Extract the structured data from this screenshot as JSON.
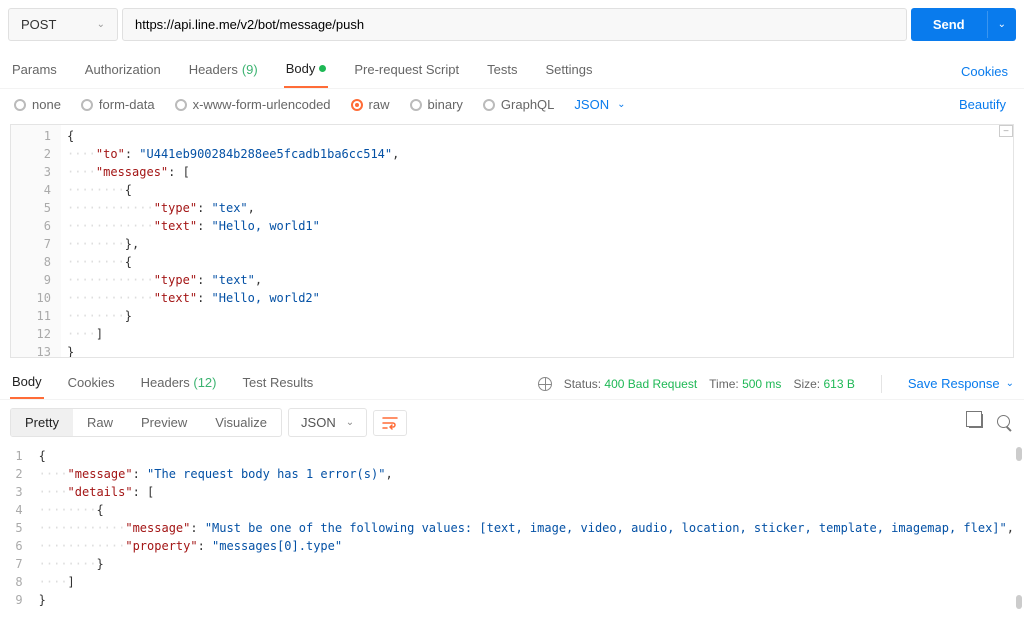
{
  "method": "POST",
  "url": "https://api.line.me/v2/bot/message/push",
  "send_label": "Send",
  "tabs": {
    "params": "Params",
    "authorization": "Authorization",
    "headers": "Headers",
    "headers_count": "(9)",
    "body": "Body",
    "prerequest": "Pre-request Script",
    "tests": "Tests",
    "settings": "Settings",
    "cookies": "Cookies"
  },
  "body_types": {
    "none": "none",
    "formdata": "form-data",
    "xwww": "x-www-form-urlencoded",
    "raw": "raw",
    "binary": "binary",
    "graphql": "GraphQL"
  },
  "body_format": "JSON",
  "beautify": "Beautify",
  "request_body_lines": [
    {
      "n": 1,
      "t": "{"
    },
    {
      "n": 2,
      "t": "    \"to\": \"U441eb900284b288ee5fcadb1ba6cc514\","
    },
    {
      "n": 3,
      "t": "    \"messages\": ["
    },
    {
      "n": 4,
      "t": "        {"
    },
    {
      "n": 5,
      "t": "            \"type\": \"tex\","
    },
    {
      "n": 6,
      "t": "            \"text\": \"Hello, world1\""
    },
    {
      "n": 7,
      "t": "        },"
    },
    {
      "n": 8,
      "t": "        {"
    },
    {
      "n": 9,
      "t": "            \"type\": \"text\","
    },
    {
      "n": 10,
      "t": "            \"text\": \"Hello, world2\""
    },
    {
      "n": 11,
      "t": "        }"
    },
    {
      "n": 12,
      "t": "    ]"
    },
    {
      "n": 13,
      "t": "}"
    }
  ],
  "request_body_json": {
    "to": "U441eb900284b288ee5fcadb1ba6cc514",
    "messages": [
      {
        "type": "tex",
        "text": "Hello, world1"
      },
      {
        "type": "text",
        "text": "Hello, world2"
      }
    ]
  },
  "response_tabs": {
    "body": "Body",
    "cookies": "Cookies",
    "headers": "Headers",
    "headers_count": "(12)",
    "test_results": "Test Results"
  },
  "response_meta": {
    "status_label": "Status:",
    "status_value": "400 Bad Request",
    "time_label": "Time:",
    "time_value": "500 ms",
    "size_label": "Size:",
    "size_value": "613 B",
    "save": "Save Response"
  },
  "response_views": {
    "pretty": "Pretty",
    "raw": "Raw",
    "preview": "Preview",
    "visualize": "Visualize"
  },
  "response_format": "JSON",
  "response_body_lines": [
    {
      "n": 1,
      "t": "{"
    },
    {
      "n": 2,
      "t": "    \"message\": \"The request body has 1 error(s)\","
    },
    {
      "n": 3,
      "t": "    \"details\": ["
    },
    {
      "n": 4,
      "t": "        {"
    },
    {
      "n": 5,
      "t": "            \"message\": \"Must be one of the following values: [text, image, video, audio, location, sticker, template, imagemap, flex]\","
    },
    {
      "n": 6,
      "t": "            \"property\": \"messages[0].type\""
    },
    {
      "n": 7,
      "t": "        }"
    },
    {
      "n": 8,
      "t": "    ]"
    },
    {
      "n": 9,
      "t": "}"
    }
  ],
  "response_body_json": {
    "message": "The request body has 1 error(s)",
    "details": [
      {
        "message": "Must be one of the following values: [text, image, video, audio, location, sticker, template, imagemap, flex]",
        "property": "messages[0].type"
      }
    ]
  }
}
